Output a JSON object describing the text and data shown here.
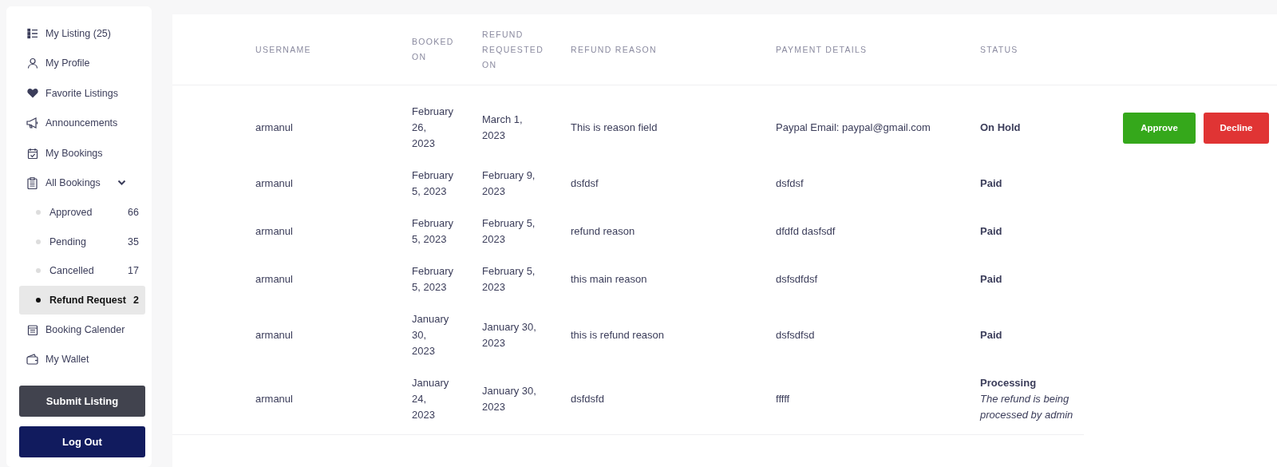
{
  "sidebar": {
    "items": [
      {
        "kind": "link",
        "label": "My Listing (25)"
      },
      {
        "kind": "link",
        "label": "My Profile"
      },
      {
        "kind": "link",
        "label": "Favorite Listings"
      },
      {
        "kind": "link",
        "label": "Announcements"
      },
      {
        "kind": "link",
        "label": "My Bookings"
      },
      {
        "kind": "group",
        "label": "All Bookings",
        "expanded": true,
        "children": [
          {
            "label": "Approved",
            "count": "66",
            "selected": false
          },
          {
            "label": "Pending",
            "count": "35",
            "selected": false
          },
          {
            "label": "Cancelled",
            "count": "17",
            "selected": false
          },
          {
            "label": "Refund Request",
            "count": "2",
            "selected": true
          }
        ]
      },
      {
        "kind": "link",
        "label": "Booking Calender"
      },
      {
        "kind": "link",
        "label": "My Wallet"
      }
    ],
    "buttons": [
      {
        "kind": "dark",
        "label": "Submit Listing"
      },
      {
        "kind": "navy",
        "label": "Log Out"
      }
    ]
  },
  "table": {
    "columns": [
      "USERNAME",
      "BOOKED ON",
      "REFUND REQUESTED ON",
      "REFUND REASON",
      "PAYMENT DETAILS",
      "STATUS"
    ],
    "rows": [
      {
        "username": "armanul",
        "booked_on": "February 26, 2023",
        "requested_on": "March 1, 2023",
        "reason": "This is reason field",
        "payment": "Paypal Email: paypal@gmail.com",
        "status": "On Hold",
        "actions": [
          {
            "kind": "approve",
            "label": "Approve"
          },
          {
            "kind": "decline",
            "label": "Decline"
          }
        ]
      },
      {
        "username": "armanul",
        "booked_on": "February 5, 2023",
        "requested_on": "February 9, 2023",
        "reason": "dsfdsf",
        "payment": "dsfdsf",
        "status": "Paid"
      },
      {
        "username": "armanul",
        "booked_on": "February 5, 2023",
        "requested_on": "February 5, 2023",
        "reason": "refund reason",
        "payment": "dfdfd dasfsdf",
        "status": "Paid"
      },
      {
        "username": "armanul",
        "booked_on": "February 5, 2023",
        "requested_on": "February 5, 2023",
        "reason": "this main reason",
        "payment": "dsfsdfdsf",
        "status": "Paid"
      },
      {
        "username": "armanul",
        "booked_on": "January 30, 2023",
        "requested_on": "January 30, 2023",
        "reason": "this is refund reason",
        "payment": "dsfsdfsd",
        "status": "Paid"
      },
      {
        "username": "armanul",
        "booked_on": "January 24, 2023",
        "requested_on": "January 30, 2023",
        "reason": "dsfdsfd",
        "payment": "fffff",
        "status": "Processing",
        "status_note": "The refund is being processed by admin"
      }
    ]
  }
}
